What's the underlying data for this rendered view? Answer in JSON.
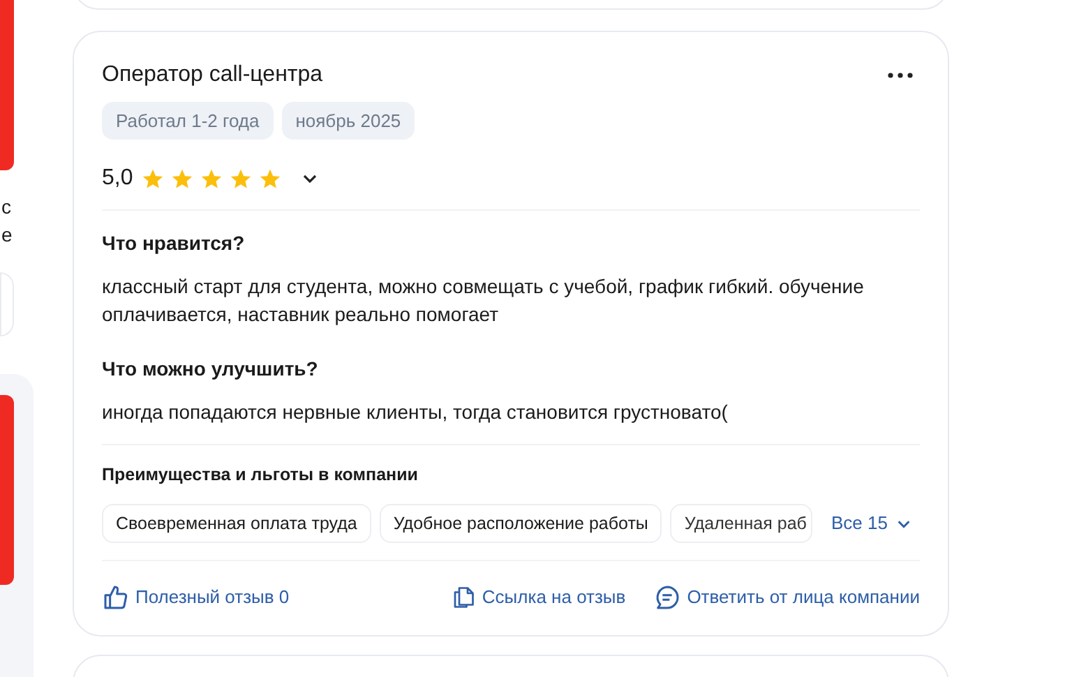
{
  "left_column": {
    "fragments": [
      "с",
      "е"
    ]
  },
  "review": {
    "title": "Оператор call-центра",
    "tags": [
      "Работал 1-2 года",
      "ноябрь 2025"
    ],
    "rating": {
      "value": "5,0",
      "stars": 5
    },
    "sections": [
      {
        "heading": "Что нравится?",
        "text": "классный старт для студента, можно совмещать с учебой, график гибкий. обучение оплачивается, наставник реально помогает"
      },
      {
        "heading": "Что можно улучшить?",
        "text": "иногда попадаются нервные клиенты, тогда становится грустновато("
      }
    ],
    "benefits": {
      "heading": "Преимущества и льготы в компании",
      "items": [
        "Своевременная оплата труда",
        "Удобное расположение работы",
        "Удаленная раб"
      ],
      "more": "Все 15"
    },
    "actions": [
      {
        "kind": "like",
        "label": "Полезный отзыв 0"
      },
      {
        "kind": "link",
        "label": "Ссылка на отзыв"
      },
      {
        "kind": "reply",
        "label": "Ответить от лица компании"
      }
    ]
  }
}
